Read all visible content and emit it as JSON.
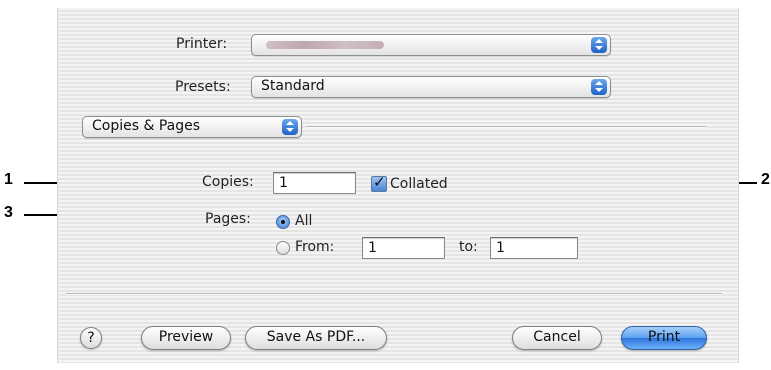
{
  "printer": {
    "label": "Printer:",
    "value": ""
  },
  "presets": {
    "label": "Presets:",
    "value": "Standard"
  },
  "panel_menu": {
    "value": "Copies & Pages"
  },
  "copies": {
    "label": "Copies:",
    "value": "1",
    "collated_label": "Collated",
    "collated_checked": true
  },
  "pages": {
    "label": "Pages:",
    "all_label": "All",
    "all_selected": true,
    "from_label": "From:",
    "from_value": "1",
    "to_label": "to:",
    "to_value": "1"
  },
  "buttons": {
    "help": "?",
    "preview": "Preview",
    "save_pdf": "Save As PDF...",
    "cancel": "Cancel",
    "print": "Print"
  },
  "callouts": {
    "c1": "1",
    "c2": "2",
    "c3": "3"
  },
  "colors": {
    "accent": "#2c74dc",
    "dialog_bg": "#ececec"
  }
}
